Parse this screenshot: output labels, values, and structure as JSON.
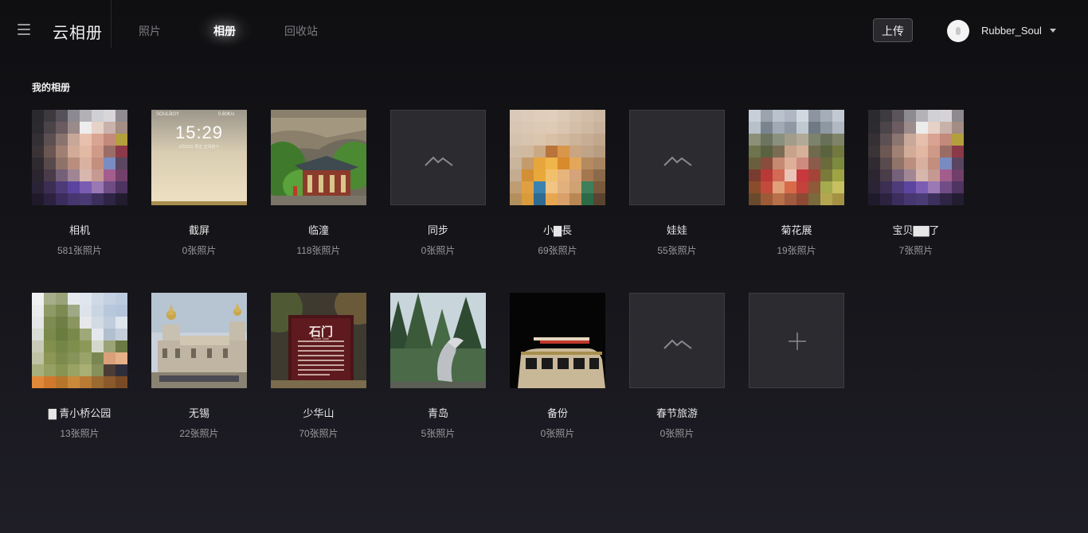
{
  "header": {
    "app_title": "云相册",
    "tabs": [
      {
        "label": "照片",
        "active": false
      },
      {
        "label": "相册",
        "active": true
      },
      {
        "label": "回收站",
        "active": false
      }
    ],
    "upload_label": "上传",
    "username": "Rubber_Soul"
  },
  "section_title": "我的相册",
  "albums": [
    {
      "name": "相机",
      "count": "581张照片",
      "cover": "mosaic-portrait"
    },
    {
      "name": "截屏",
      "count": "0张照片",
      "cover": "lockscreen"
    },
    {
      "name": "临潼",
      "count": "118张照片",
      "cover": "temple"
    },
    {
      "name": "同步",
      "count": "0张照片",
      "cover": "placeholder"
    },
    {
      "name": "小▇長",
      "count": "69张照片",
      "cover": "mosaic-child"
    },
    {
      "name": "娃娃",
      "count": "55张照片",
      "cover": "placeholder"
    },
    {
      "name": "菊花展",
      "count": "19张照片",
      "cover": "mosaic-flowers"
    },
    {
      "name": "宝贝▇▇了",
      "count": "7张照片",
      "cover": "mosaic-portrait"
    },
    {
      "name": "▇ 青小桥公园",
      "count": "13张照片",
      "cover": "mosaic-park"
    },
    {
      "name": "无锡",
      "count": "22张照片",
      "cover": "palace"
    },
    {
      "name": "少华山",
      "count": "70张照片",
      "cover": "stone-gate"
    },
    {
      "name": "青岛",
      "count": "5张照片",
      "cover": "trees"
    },
    {
      "name": "备份",
      "count": "0张照片",
      "cover": "car"
    },
    {
      "name": "春节旅游",
      "count": "0张照片",
      "cover": "placeholder"
    }
  ],
  "lockscreen": {
    "carrier": "SOULBOY",
    "status": "0.60K/s",
    "time": "15:29",
    "date": "2月15日 周五  正月初十"
  },
  "stone_gate": {
    "title": "石门",
    "subtitle": "Stone Gate"
  },
  "add_album": {
    "icon": "plus-icon"
  },
  "colors": {
    "background": "#131317",
    "accent_text": "#ffffff",
    "muted_text": "#9a9a9e",
    "placeholder_tile": "#2b2b30"
  }
}
